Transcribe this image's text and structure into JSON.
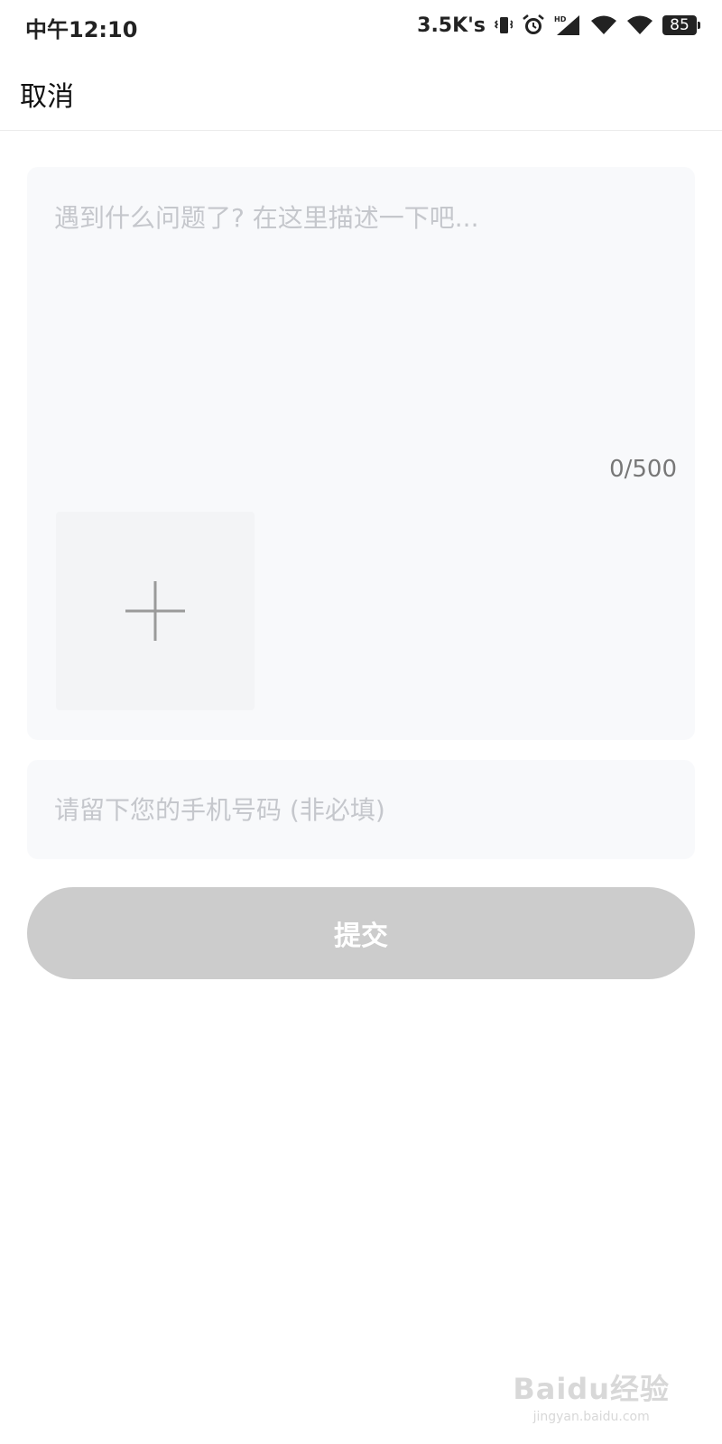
{
  "status_bar": {
    "time": "中午12:10",
    "network_speed": "3.5K's",
    "battery": "85",
    "icons": [
      "vibrate-icon",
      "alarm-icon",
      "signal-hd-icon",
      "wifi-icon",
      "wifi-icon"
    ]
  },
  "header": {
    "cancel_label": "取消"
  },
  "feedback": {
    "placeholder": "遇到什么问题了? 在这里描述一下吧...",
    "counter": "0/500",
    "add_image_icon": "plus-icon"
  },
  "phone": {
    "placeholder": "请留下您的手机号码 (非必填)"
  },
  "submit": {
    "label": "提交",
    "color": "#cccccc"
  },
  "watermark": {
    "logo": "Baidu经验",
    "url": "jingyan.baidu.com"
  }
}
